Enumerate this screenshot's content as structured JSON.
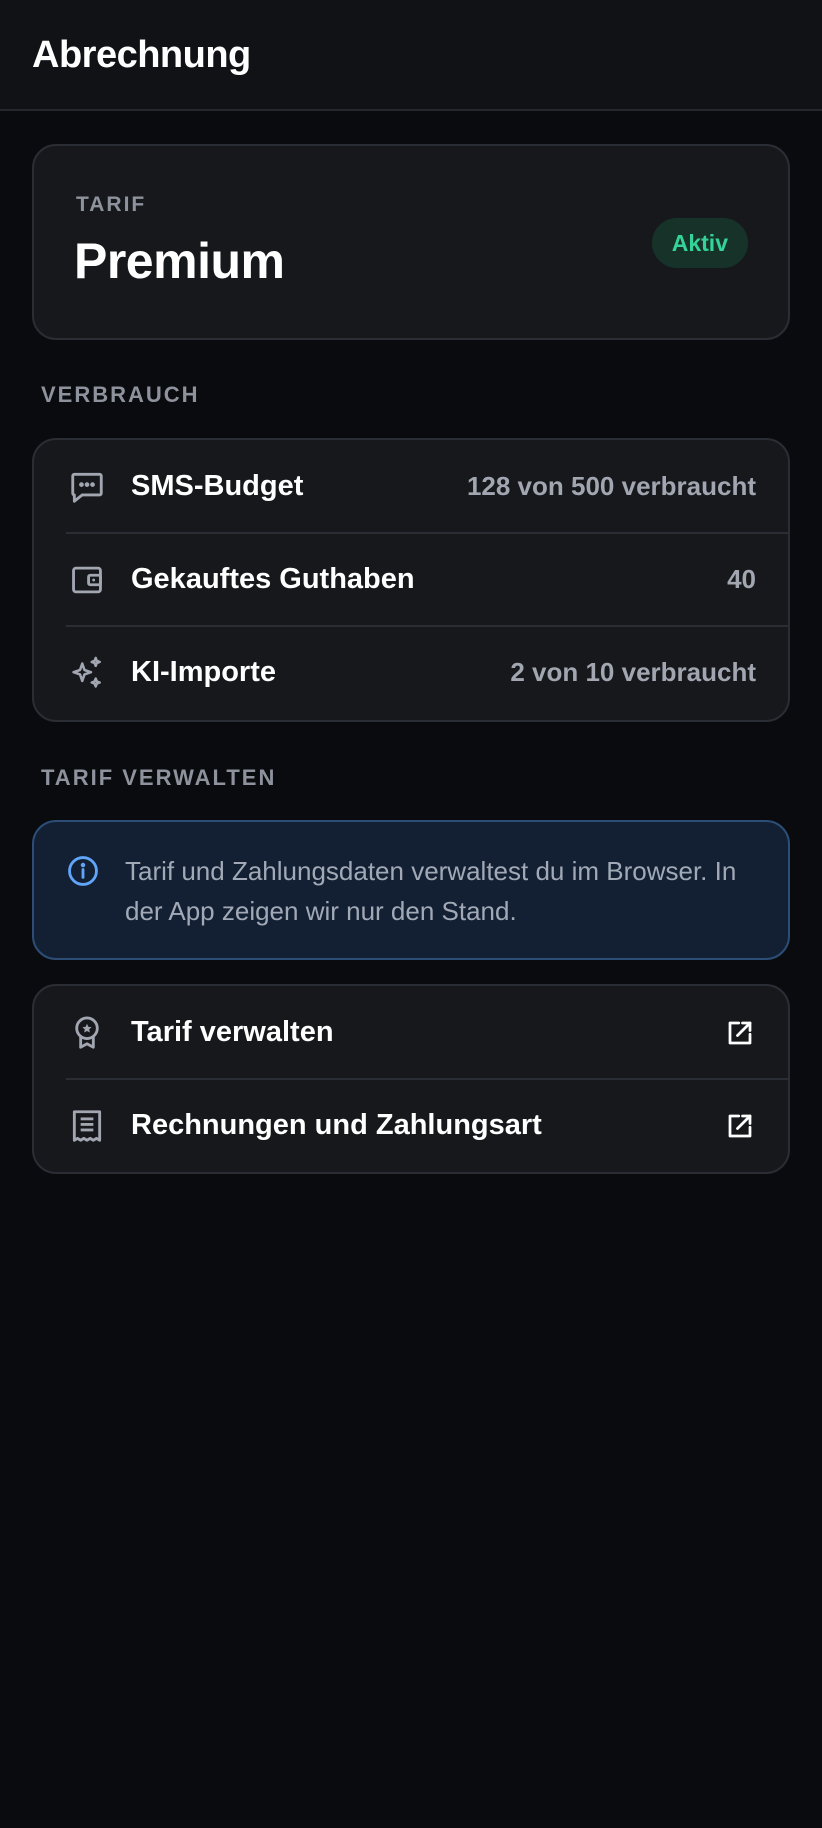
{
  "header": {
    "title": "Abrechnung"
  },
  "plan": {
    "eyebrow": "TARIF",
    "name": "Premium",
    "status": "Aktiv"
  },
  "usage": {
    "section_label": "VERBRAUCH",
    "items": [
      {
        "icon": "message-dots-icon",
        "label": "SMS-Budget",
        "value": "128 von 500 verbraucht"
      },
      {
        "icon": "wallet-icon",
        "label": "Gekauftes Guthaben",
        "value": "40"
      },
      {
        "icon": "sparkles-icon",
        "label": "KI-Importe",
        "value": "2 von 10 verbraucht"
      }
    ]
  },
  "manage": {
    "section_label": "TARIF VERWALTEN",
    "info_text": "Tarif und Zahlungsdaten verwaltest du im Browser. In der App zeigen wir nur den Stand.",
    "items": [
      {
        "icon": "award-icon",
        "label": "Tarif verwalten",
        "action_icon": "external-link-icon"
      },
      {
        "icon": "receipt-icon",
        "label": "Rechnungen und Zahlungsart",
        "action_icon": "external-link-icon"
      }
    ]
  },
  "colors": {
    "background": "#0a0b0e",
    "card": "#16181c",
    "accent_green": "#34d399",
    "info_blue": "#60a5fa"
  }
}
